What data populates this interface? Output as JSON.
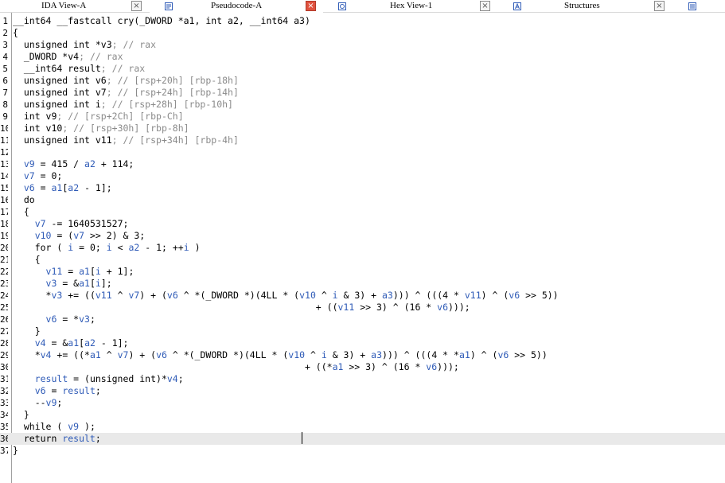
{
  "tabs": [
    {
      "id": "ida-view",
      "label": "IDA View-A",
      "icon": "ida-view-icon",
      "close": "×",
      "active": false
    },
    {
      "id": "pseudocode",
      "label": "Pseudocode-A",
      "icon": "pseudocode-icon",
      "close": "×",
      "active": true
    },
    {
      "id": "hex-view",
      "label": "Hex View-1",
      "icon": "hex-view-icon",
      "close": "×",
      "active": false
    },
    {
      "id": "structures",
      "label": "Structures",
      "icon": "structures-icon",
      "close": "×",
      "active": false
    },
    {
      "id": "enums",
      "label": "",
      "icon": "enums-icon",
      "close": "",
      "active": false
    }
  ],
  "colors": {
    "code": "#000000",
    "variable": "#2f5bb7",
    "comment": "#8a8a8a",
    "current_line": "#e9e9e9"
  },
  "editor": {
    "current_line": 36,
    "lines": [
      {
        "num": "1",
        "tokens": [
          [
            "__int64 __fastcall cry(_DWORD *a1, int a2, __int64 a3)",
            "t"
          ]
        ]
      },
      {
        "num": "2",
        "tokens": [
          [
            "{",
            "t"
          ]
        ]
      },
      {
        "num": "3",
        "tokens": [
          [
            "  unsigned int *",
            "t"
          ],
          [
            "v3",
            "t"
          ],
          [
            "; // rax",
            "c"
          ]
        ]
      },
      {
        "num": "4",
        "tokens": [
          [
            "  _DWORD *",
            "t"
          ],
          [
            "v4",
            "t"
          ],
          [
            "; // rax",
            "c"
          ]
        ]
      },
      {
        "num": "5",
        "tokens": [
          [
            "  __int64 ",
            "t"
          ],
          [
            "result",
            "t"
          ],
          [
            "; // rax",
            "c"
          ]
        ]
      },
      {
        "num": "6",
        "tokens": [
          [
            "  unsigned int ",
            "t"
          ],
          [
            "v6",
            "t"
          ],
          [
            "; // [rsp+20h] [rbp-18h]",
            "c"
          ]
        ]
      },
      {
        "num": "7",
        "tokens": [
          [
            "  unsigned int ",
            "t"
          ],
          [
            "v7",
            "t"
          ],
          [
            "; // [rsp+24h] [rbp-14h]",
            "c"
          ]
        ]
      },
      {
        "num": "8",
        "tokens": [
          [
            "  unsigned int ",
            "t"
          ],
          [
            "i",
            "t"
          ],
          [
            "; // [rsp+28h] [rbp-10h]",
            "c"
          ]
        ]
      },
      {
        "num": "9",
        "tokens": [
          [
            "  int ",
            "t"
          ],
          [
            "v9",
            "t"
          ],
          [
            "; // [rsp+2Ch] [rbp-Ch]",
            "c"
          ]
        ]
      },
      {
        "num": "10",
        "tokens": [
          [
            "  int ",
            "t"
          ],
          [
            "v10",
            "t"
          ],
          [
            "; // [rsp+30h] [rbp-8h]",
            "c"
          ]
        ]
      },
      {
        "num": "11",
        "tokens": [
          [
            "  unsigned int ",
            "t"
          ],
          [
            "v11",
            "t"
          ],
          [
            "; // [rsp+34h] [rbp-4h]",
            "c"
          ]
        ]
      },
      {
        "num": "12",
        "tokens": [
          [
            "",
            "t"
          ]
        ]
      },
      {
        "num": "13",
        "tokens": [
          [
            "  ",
            "t"
          ],
          [
            "v9",
            "v"
          ],
          [
            " = 415 / ",
            "t"
          ],
          [
            "a2",
            "v"
          ],
          [
            " + 114;",
            "t"
          ]
        ]
      },
      {
        "num": "14",
        "tokens": [
          [
            "  ",
            "t"
          ],
          [
            "v7",
            "v"
          ],
          [
            " = 0;",
            "t"
          ]
        ]
      },
      {
        "num": "15",
        "tokens": [
          [
            "  ",
            "t"
          ],
          [
            "v6",
            "v"
          ],
          [
            " = ",
            "t"
          ],
          [
            "a1",
            "v"
          ],
          [
            "[",
            "t"
          ],
          [
            "a2",
            "v"
          ],
          [
            " - 1];",
            "t"
          ]
        ]
      },
      {
        "num": "16",
        "tokens": [
          [
            "  do",
            "t"
          ]
        ]
      },
      {
        "num": "17",
        "tokens": [
          [
            "  {",
            "t"
          ]
        ]
      },
      {
        "num": "18",
        "tokens": [
          [
            "    ",
            "t"
          ],
          [
            "v7",
            "v"
          ],
          [
            " -= 1640531527;",
            "t"
          ]
        ]
      },
      {
        "num": "19",
        "tokens": [
          [
            "    ",
            "t"
          ],
          [
            "v10",
            "v"
          ],
          [
            " = (",
            "t"
          ],
          [
            "v7",
            "v"
          ],
          [
            " >> 2) & 3;",
            "t"
          ]
        ]
      },
      {
        "num": "20",
        "tokens": [
          [
            "    for ( ",
            "t"
          ],
          [
            "i",
            "v"
          ],
          [
            " = 0; ",
            "t"
          ],
          [
            "i",
            "v"
          ],
          [
            " < ",
            "t"
          ],
          [
            "a2",
            "v"
          ],
          [
            " - 1; ++",
            "t"
          ],
          [
            "i",
            "v"
          ],
          [
            " )",
            "t"
          ]
        ]
      },
      {
        "num": "21",
        "tokens": [
          [
            "    {",
            "t"
          ]
        ]
      },
      {
        "num": "22",
        "tokens": [
          [
            "      ",
            "t"
          ],
          [
            "v11",
            "v"
          ],
          [
            " = ",
            "t"
          ],
          [
            "a1",
            "v"
          ],
          [
            "[",
            "t"
          ],
          [
            "i",
            "v"
          ],
          [
            " + 1];",
            "t"
          ]
        ]
      },
      {
        "num": "23",
        "tokens": [
          [
            "      ",
            "t"
          ],
          [
            "v3",
            "v"
          ],
          [
            " = &",
            "t"
          ],
          [
            "a1",
            "v"
          ],
          [
            "[",
            "t"
          ],
          [
            "i",
            "v"
          ],
          [
            "];",
            "t"
          ]
        ]
      },
      {
        "num": "24",
        "tokens": [
          [
            "      *",
            "t"
          ],
          [
            "v3",
            "v"
          ],
          [
            " += ((",
            "t"
          ],
          [
            "v11",
            "v"
          ],
          [
            " ^ ",
            "t"
          ],
          [
            "v7",
            "v"
          ],
          [
            ") + (",
            "t"
          ],
          [
            "v6",
            "v"
          ],
          [
            " ^ *(_DWORD *)(4LL * (",
            "t"
          ],
          [
            "v10",
            "v"
          ],
          [
            " ^ ",
            "t"
          ],
          [
            "i",
            "v"
          ],
          [
            " & 3) + ",
            "t"
          ],
          [
            "a3",
            "v"
          ],
          [
            "))) ^ (((4 * ",
            "t"
          ],
          [
            "v11",
            "v"
          ],
          [
            ") ^ (",
            "t"
          ],
          [
            "v6",
            "v"
          ],
          [
            " >> 5))",
            "t"
          ]
        ]
      },
      {
        "num": "25",
        "tokens": [
          [
            "                                                       + ((",
            "t"
          ],
          [
            "v11",
            "v"
          ],
          [
            " >> 3) ^ (16 * ",
            "t"
          ],
          [
            "v6",
            "v"
          ],
          [
            ")));",
            "t"
          ]
        ]
      },
      {
        "num": "26",
        "tokens": [
          [
            "      ",
            "t"
          ],
          [
            "v6",
            "v"
          ],
          [
            " = *",
            "t"
          ],
          [
            "v3",
            "v"
          ],
          [
            ";",
            "t"
          ]
        ]
      },
      {
        "num": "27",
        "tokens": [
          [
            "    }",
            "t"
          ]
        ]
      },
      {
        "num": "28",
        "tokens": [
          [
            "    ",
            "t"
          ],
          [
            "v4",
            "v"
          ],
          [
            " = &",
            "t"
          ],
          [
            "a1",
            "v"
          ],
          [
            "[",
            "t"
          ],
          [
            "a2",
            "v"
          ],
          [
            " - 1];",
            "t"
          ]
        ]
      },
      {
        "num": "29",
        "tokens": [
          [
            "    *",
            "t"
          ],
          [
            "v4",
            "v"
          ],
          [
            " += ((*",
            "t"
          ],
          [
            "a1",
            "v"
          ],
          [
            " ^ ",
            "t"
          ],
          [
            "v7",
            "v"
          ],
          [
            ") + (",
            "t"
          ],
          [
            "v6",
            "v"
          ],
          [
            " ^ *(_DWORD *)(4LL * (",
            "t"
          ],
          [
            "v10",
            "v"
          ],
          [
            " ^ ",
            "t"
          ],
          [
            "i",
            "v"
          ],
          [
            " & 3) + ",
            "t"
          ],
          [
            "a3",
            "v"
          ],
          [
            "))) ^ (((4 * *",
            "t"
          ],
          [
            "a1",
            "v"
          ],
          [
            ") ^ (",
            "t"
          ],
          [
            "v6",
            "v"
          ],
          [
            " >> 5))",
            "t"
          ]
        ]
      },
      {
        "num": "30",
        "tokens": [
          [
            "                                                     + ((*",
            "t"
          ],
          [
            "a1",
            "v"
          ],
          [
            " >> 3) ^ (16 * ",
            "t"
          ],
          [
            "v6",
            "v"
          ],
          [
            ")));",
            "t"
          ]
        ]
      },
      {
        "num": "31",
        "tokens": [
          [
            "    ",
            "t"
          ],
          [
            "result",
            "v"
          ],
          [
            " = (unsigned int)*",
            "t"
          ],
          [
            "v4",
            "v"
          ],
          [
            ";",
            "t"
          ]
        ]
      },
      {
        "num": "32",
        "tokens": [
          [
            "    ",
            "t"
          ],
          [
            "v6",
            "v"
          ],
          [
            " = ",
            "t"
          ],
          [
            "result",
            "v"
          ],
          [
            ";",
            "t"
          ]
        ]
      },
      {
        "num": "33",
        "tokens": [
          [
            "    --",
            "t"
          ],
          [
            "v9",
            "v"
          ],
          [
            ";",
            "t"
          ]
        ]
      },
      {
        "num": "34",
        "tokens": [
          [
            "  }",
            "t"
          ]
        ]
      },
      {
        "num": "35",
        "tokens": [
          [
            "  while ( ",
            "t"
          ],
          [
            "v9",
            "v"
          ],
          [
            " );",
            "t"
          ]
        ]
      },
      {
        "num": "36",
        "tokens": [
          [
            "  return ",
            "t"
          ],
          [
            "result",
            "v"
          ],
          [
            ";",
            "t"
          ]
        ]
      },
      {
        "num": "37",
        "tokens": [
          [
            "}",
            "t"
          ]
        ]
      }
    ]
  }
}
